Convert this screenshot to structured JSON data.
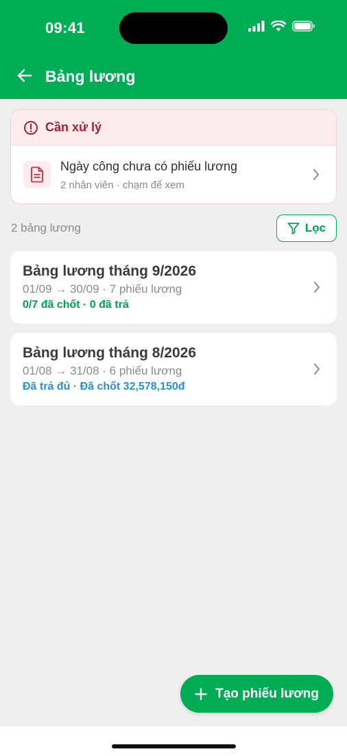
{
  "status_bar": {
    "time": "09:41"
  },
  "header": {
    "title": "Bảng lương"
  },
  "alert": {
    "title": "Cần xử lý",
    "item": {
      "title": "Ngày công chưa có phiếu lương",
      "subtitle": "2 nhân viên · chạm để xem"
    }
  },
  "list": {
    "count_label": "2 bảng lương",
    "filter_label": "Lọc",
    "payrolls": [
      {
        "title": "Bảng lương tháng 9/2026",
        "range": "01/09 → 30/09 · 7 phiếu lương",
        "status": "0/7 đã chốt · 0 đã trả",
        "status_color": "#00a14f"
      },
      {
        "title": "Bảng lương tháng 8/2026",
        "range": "01/08 → 31/08 · 6 phiếu lương",
        "status": "Đã trả đủ · Đã chốt 32,578,150đ",
        "status_color": "#2a8fd8"
      }
    ]
  },
  "fab": {
    "label": "Tạo phiếu lương"
  },
  "colors": {
    "brand_green": "#00ad55",
    "alert_red": "#a52231",
    "link_blue": "#2a8fd8"
  }
}
